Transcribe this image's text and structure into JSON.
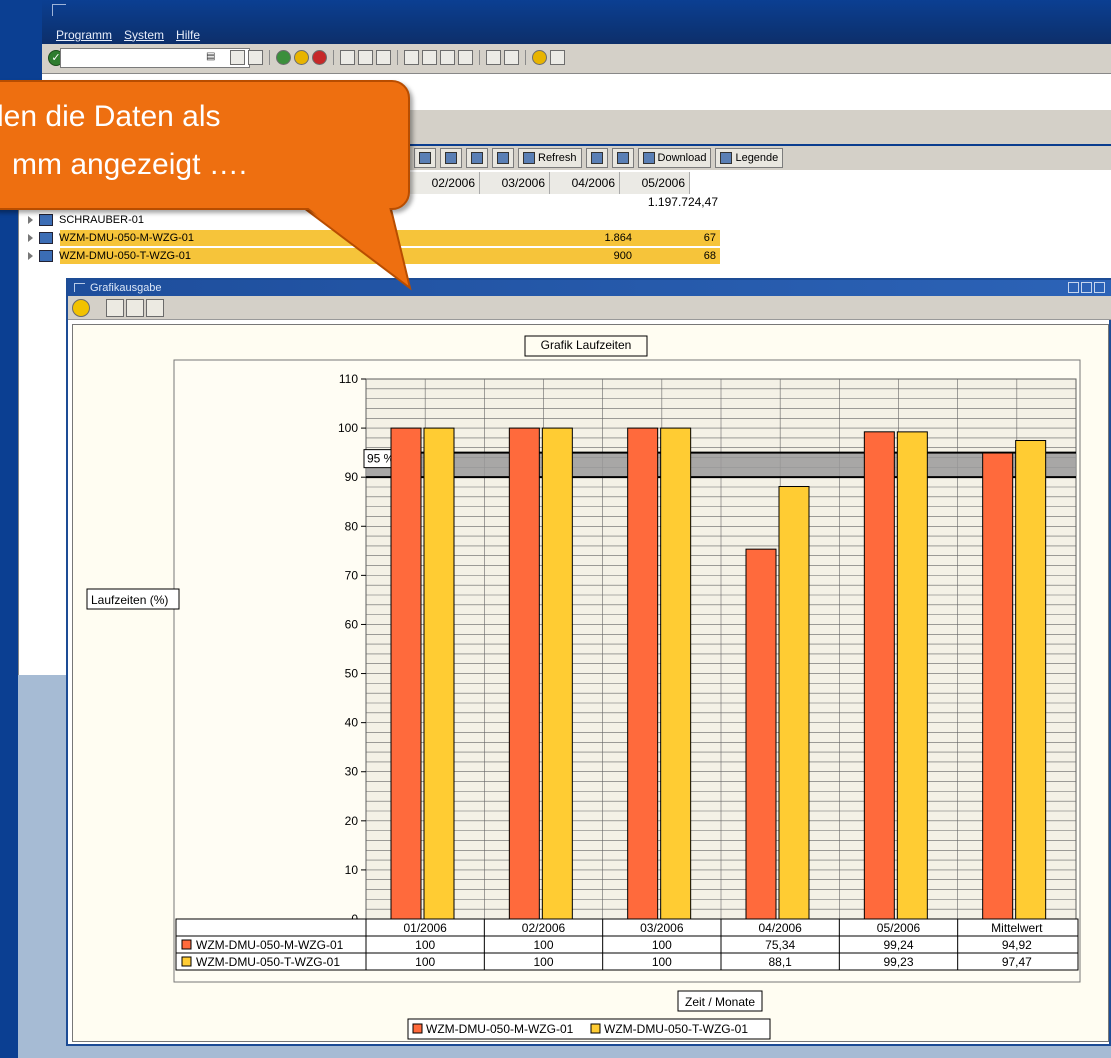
{
  "window": {
    "menu": [
      "Programm",
      "System",
      "Hilfe"
    ]
  },
  "callout": {
    "line1": "den die Daten als",
    "line2": "mm angezeigt …."
  },
  "alv": {
    "buttons": {
      "refresh": "Refresh",
      "download": "Download",
      "legend": "Legende"
    },
    "columns": [
      "02/2006",
      "03/2006",
      "04/2006",
      "05/2006"
    ],
    "total_05": "1.197.724,47",
    "rows": [
      {
        "name": "SCHRAUBER-01",
        "v04": "",
        "v05": ""
      },
      {
        "name": "WZM-DMU-050-M-WZG-01",
        "v04": "1.864",
        "v05": "67"
      },
      {
        "name": "WZM-DMU-050-T-WZG-01",
        "v04": "900",
        "v05": "68"
      }
    ]
  },
  "dialog": {
    "title": "Grafikausgabe"
  },
  "chart_data": {
    "type": "bar",
    "title": "Grafik Laufzeiten",
    "ylabel": "Laufzeiten (%)",
    "xlabel": "Zeit / Monate",
    "ylim": [
      0,
      110
    ],
    "yticks": [
      0,
      10,
      20,
      30,
      40,
      50,
      60,
      70,
      80,
      90,
      100,
      110
    ],
    "categories": [
      "01/2006",
      "02/2006",
      "03/2006",
      "04/2006",
      "05/2006",
      "Mittelwert"
    ],
    "series": [
      {
        "name": "WZM-DMU-050-M-WZG-01",
        "color": "#ff6a3c",
        "values": [
          100,
          100,
          100,
          75.34,
          99.24,
          94.92
        ],
        "labels": [
          "100",
          "100",
          "100",
          "75,34",
          "99,24",
          "94,92"
        ]
      },
      {
        "name": "WZM-DMU-050-T-WZG-01",
        "color": "#ffcc33",
        "values": [
          100,
          100,
          100,
          88.1,
          99.23,
          97.47
        ],
        "labels": [
          "100",
          "100",
          "100",
          "88,1",
          "99,23",
          "97,47"
        ]
      }
    ],
    "target_label": "95 %",
    "target_band": [
      90,
      95
    ],
    "grid": true,
    "legend_position": "bottom"
  }
}
